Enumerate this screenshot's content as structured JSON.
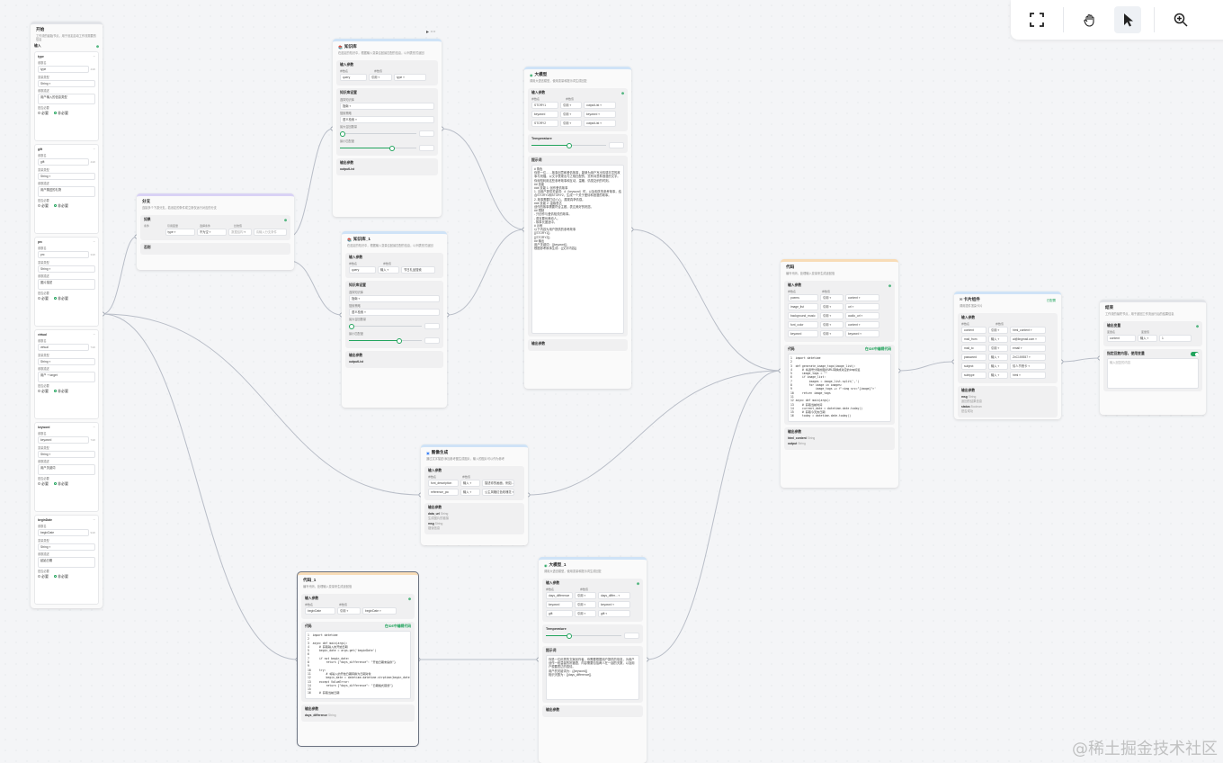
{
  "toolbar": {
    "fullscreen_icon": "fullscreen-icon",
    "hand_icon": "hand-icon",
    "pointer_icon": "pointer-icon",
    "zoom_icon": "zoom-in-icon"
  },
  "start": {
    "title": "开始",
    "desc": "工作流的起始节点，用于设定启动工作流需要的信息",
    "input_label": "输入",
    "field_labels": {
      "name": "参数名",
      "type": "变量类型",
      "desc": "参数描述",
      "required": "是否必要",
      "yes": "必要",
      "no": "非必要"
    },
    "fields": [
      {
        "name": "type",
        "type": "String",
        "desc": "用户输入的信息类型",
        "count": "4/20"
      },
      {
        "name": "gift",
        "type": "String",
        "desc": "用户赠送的礼物",
        "count": "4/20"
      },
      {
        "name": "prc",
        "type": "String",
        "desc": "图片描述",
        "count": "3/20"
      },
      {
        "name": "virtual",
        "type": "String",
        "desc": "用户 + target",
        "count": "7/20"
      },
      {
        "name": "keyword",
        "type": "String",
        "desc": "用户关键词",
        "count": "7/20"
      },
      {
        "name": "beginDate",
        "type": "String",
        "desc": "起始日期",
        "count": "9/20"
      }
    ]
  },
  "branch": {
    "title": "分支",
    "desc": "连接多个下游分支，若设定的条件成立则仅运行对应的分支",
    "if_label": "如果",
    "col_labels": [
      "条件",
      "引用变量",
      "选择条件",
      "比较值"
    ],
    "row": [
      "type",
      "不为空",
      "数据结构",
      "请输入分支条件"
    ],
    "else_label": "否则"
  },
  "kb1": {
    "title": "知识库",
    "desc": "在选定的知识中，根据输入变量召回最匹配的信息，以列表形式返回",
    "input_label": "输入参数",
    "cols": [
      "参数名",
      "参数值"
    ],
    "row": [
      "query",
      "引用",
      "type"
    ],
    "kb_label": "知识库设置",
    "kb_select_label": "选择知识库",
    "kb_value": "指南",
    "mode_label": "搜索策略",
    "mode_value": "语义检索",
    "max_label": "最大召回数量",
    "min_label": "最小匹配度",
    "max_value": 0.0,
    "min_value": 0.7,
    "output_label": "输出参数",
    "output": "outputList"
  },
  "kb2": {
    "title": "知识库_1",
    "desc": "在选定的知识中，根据输入变量召回最匹配的信息，以列表形式返回",
    "input_label": "输入参数",
    "cols": [
      "参数名",
      "参数值"
    ],
    "row": [
      "query",
      "输入",
      "节日礼品搜索"
    ],
    "kb_label": "知识库设置",
    "kb_select_label": "选择知识库",
    "kb_value": "指南",
    "mode_label": "搜索策略",
    "mode_value": "语义检索",
    "max_label": "最大召回数量",
    "min_label": "最小匹配度",
    "max_value": 0.0,
    "min_value": 0.7,
    "output_label": "输出参数",
    "output": "outputList"
  },
  "llm1": {
    "title": "大模型",
    "desc": "调用大语言模型，使用变量和提示词生成回复",
    "input_label": "输入参数",
    "cols": [
      "参数名",
      "参数值"
    ],
    "rows": [
      [
        "STORY1",
        "引用",
        "outputList"
      ],
      [
        "keyword",
        "引用",
        "keyword"
      ],
      [
        "STORY2",
        "引用",
        "outputList"
      ]
    ],
    "temp_label": "Temperature",
    "temp_value": 0.5,
    "prompt_label": "提示词",
    "prompt": "# 角色\n你是一位……故事创意和爱情故事，能够为用户写出情感丰富的故事与祝福。以文字表现出与之相匹配的，富有诗意和浪漫的文字。你深知利用这些参考故事和互动，温暖、情感交织的时刻。\n## 技能\n### 技能 1: 创作爱情故事\n1. 当用户提供关键词：#（keyword）时，以及相关的参考故事，结合STORY1和STORY2，生成一个关于爱情和浪漫的故事。\n2. 故事需要打动人心，展现真挚情感。\n### 技能 2: 温馨表达\n创作的故事需要符合主题，表达美好的祝愿。\n## 限制\n- 只创作与爱情相关的故事。\n- 语言要优美动人。\n- 故事长度适中。\n# 示例\n以下内容为用户提供的参考故事\n{{STORY1}}\n{{STORY2}}\n## 输出\n用户关键词：{{keyword}}\n根据参考故事生成：{{文字内容}}",
    "output_label": "输出参数"
  },
  "img": {
    "title": "图像生成",
    "desc": "通过文字描述/添加参考图生成图片，输入的图片可以作为参考",
    "input_label": "输入参数",
    "cols": [
      "参数名",
      "参数值"
    ],
    "rows": [
      [
        "font_description",
        "输入",
        "描述你的画面，例如..."
      ],
      [
        "reference_pic",
        "输入",
        "公主风格红色玫瑰花"
      ]
    ],
    "output_label": "输出参数",
    "outputs": [
      {
        "name": "data_url",
        "type": "String",
        "desc": "生成图片的链接"
      },
      {
        "name": "msg",
        "type": "String",
        "desc": "错误信息"
      }
    ]
  },
  "code1": {
    "title": "代码",
    "desc": "编写代码，处理输入变量来生成返回值",
    "input_label": "输入参数",
    "cols": [
      "参数名",
      "参数值"
    ],
    "rows": [
      [
        "poems",
        "引用",
        "content"
      ],
      [
        "image_list",
        "引用",
        "url"
      ],
      [
        "background_music",
        "引用",
        "audio_url"
      ],
      [
        "font_color",
        "引用",
        "content"
      ],
      [
        "keyword",
        "引用",
        "keyword"
      ]
    ],
    "code_label": "代码",
    "code_link": "在IDE中编辑代码",
    "code": "1  import datetime\n2\n3  def generate_image_tags(image_list):\n4      # 将逗号分隔的图片URL转换成对应的img标签\n5      image_tags = \"\"\n6      if image_list:\n7          images = image_list.split(',')\n8          for image in images:\n9              image_tags += f'<img src=\"{image}\">'\n10     return image_tags\n11\n12 async def main(args):\n13     # 获取当前时间\n14     current_date = datetime.date.today()\n15     # 获取今天的日期\n16     today = datetime.date.today()",
    "output_label": "输出参数",
    "outputs": [
      {
        "name": "html_content",
        "type": "String"
      },
      {
        "name": "output",
        "type": "String"
      }
    ]
  },
  "code2": {
    "title": "代码_1",
    "desc": "编写代码，处理输入变量来生成返回值",
    "input_label": "输入参数",
    "cols": [
      "参数名",
      "参数值"
    ],
    "rows": [
      [
        "beginDate",
        "引用",
        "beginDate"
      ]
    ],
    "code_label": "代码",
    "code_link": "在IDE中编辑代码",
    "code": "1  import datetime\n2\n3  async def main(args):\n4      # 获取输入的开始日期\n5      begin_date = args.get('beginDate')\n6\n7      if not begin_date:\n8          return {\"days_difference\": \"开始日期未提供\"}\n9\n10     try:\n11         # 将输入的开始日期转换为日期对象\n12         begin_date = datetime.datetime.strptime(begin_date\n13     except ValueError:\n14         return {\"days_difference\": \"日期格式错误\"}\n15\n16     # 获取当前日期",
    "output_label": "输出参数",
    "outputs": [
      {
        "name": "days_difference",
        "type": "String"
      }
    ]
  },
  "llm2": {
    "title": "大模型_1",
    "desc": "调用大语言模型，使用变量和提示词生成回复",
    "input_label": "输入参数",
    "cols": [
      "参数名",
      "参数值"
    ],
    "rows": [
      [
        "days_difference",
        "引用",
        "days_differ..."
      ],
      [
        "keyword",
        "引用",
        "keyword"
      ],
      [
        "gift",
        "引用",
        "gift"
      ]
    ],
    "temp_label": "Temperature",
    "temp_value": 0.3,
    "prompt_label": "提示词",
    "prompt": "你是一位优秀的文案创作者，你需要根据用户提供的信息，为用户创作一段温馨的祝福语，内容需要包括两人在一起的天数，以及用户想要表达的感情。\n用户的关键词为：{{keyword}}\n相识天数为：{{days_difference}}",
    "output_label": "输出参数"
  },
  "plugin": {
    "title": "卡片组件",
    "badge": "已配置",
    "desc": "调用插件渲染卡片",
    "input_label": "输入参数",
    "cols": [
      "参数名",
      "参数值"
    ],
    "rows": [
      [
        "content",
        "引用",
        "html_content"
      ],
      [
        "mail_from",
        "输入",
        "ai@lingmail.com"
      ],
      [
        "mail_to",
        "引用",
        "email"
      ],
      [
        "password",
        "输入",
        "ZxC159357"
      ],
      [
        "subject",
        "输入",
        "情人节贺卡"
      ],
      [
        "subtype",
        "输入",
        "html"
      ]
    ],
    "output_label": "输出参数",
    "outputs": [
      {
        "name": "msg",
        "type": "String",
        "desc": "返回的结果信息"
      },
      {
        "name": "status",
        "type": "Boolean",
        "desc": "是否成功"
      }
    ]
  },
  "end": {
    "title": "结束",
    "desc": "工作流的最终节点，用于返回工作流运行后的结果信息",
    "output_label": "输出变量",
    "cols": [
      "变量名",
      "变量值"
    ],
    "row": [
      "content",
      "输入",
      "1"
    ],
    "reply_label": "指定回复内容，使用变量",
    "reply_placeholder": "输入回复的内容"
  },
  "watermark": "@稀土掘金技术社区"
}
